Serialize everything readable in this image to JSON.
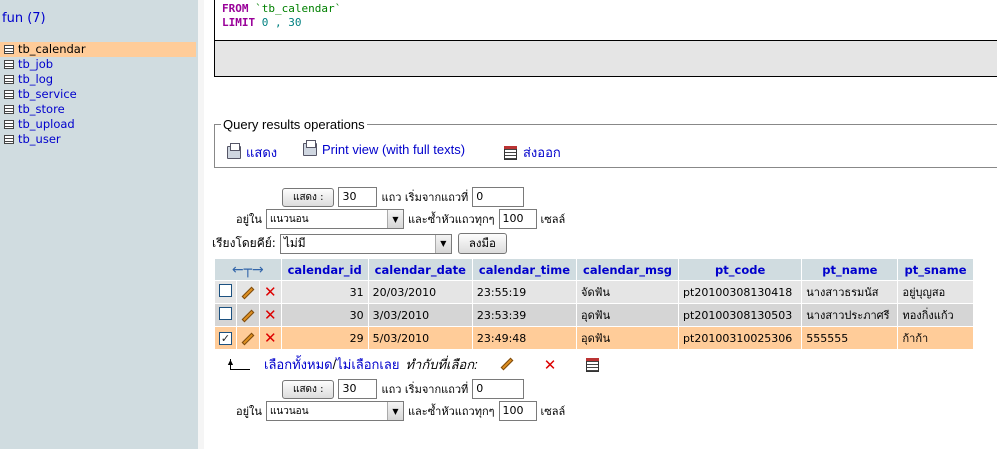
{
  "nav": {
    "db_title": "fun (7)",
    "tables": [
      "tb_calendar",
      "tb_job",
      "tb_log",
      "tb_service",
      "tb_store",
      "tb_upload",
      "tb_user"
    ]
  },
  "sql": {
    "line1_kw": "FROM",
    "line1_str": "`tb_calendar`",
    "line2_kw": "LIMIT",
    "line2_num": "0 , 30"
  },
  "ops": {
    "legend": "Query results operations",
    "show": "แสดง",
    "print_view": "Print view (with full texts)",
    "export": "ส่งออก"
  },
  "nav_form": {
    "show_button": "แสดง :",
    "rows": "30",
    "rows_label": "แถว เริ่มจากแถวที่",
    "start": "0",
    "mode_label": "อยู่ใน",
    "mode": "แนวนอน",
    "repeat_label": "และซ้ำหัวแถวทุกๆ",
    "repeat": "100",
    "cells_label": "เซลล์"
  },
  "sort": {
    "label": "เรียงโดยคีย์:",
    "value": "ไม่มี",
    "go_button": "ลงมือ"
  },
  "table": {
    "columns": [
      "calendar_id",
      "calendar_date",
      "calendar_time",
      "calendar_msg",
      "pt_code",
      "pt_name",
      "pt_sname"
    ],
    "rows": [
      {
        "checked": false,
        "cells": [
          "31",
          "20/03/2010",
          "23:55:19",
          "จัดฟัน",
          "pt20100308130418",
          "นางสาวธรมนัส",
          "อยู่บุญสอ"
        ]
      },
      {
        "checked": false,
        "cells": [
          "30",
          "3/03/2010",
          "23:53:39",
          "อุดฟัน",
          "pt20100308130503",
          "นางสาวประภาศรี",
          "ทองกิ่งแก้ว"
        ]
      },
      {
        "checked": true,
        "cells": [
          "29",
          "5/03/2010",
          "23:49:48",
          "อุดฟัน",
          "pt20100310025306",
          "555555",
          "ก้าก้า"
        ]
      }
    ]
  },
  "bulk": {
    "check_all": "เลือกทั้งหมด",
    "separator": " / ",
    "uncheck_all": "ไม่เลือกเลย",
    "with_selected": "ทำกับที่เลือก:"
  }
}
